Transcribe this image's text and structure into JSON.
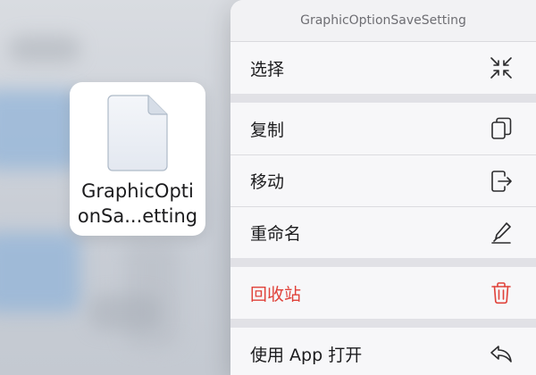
{
  "file": {
    "name_line1": "GraphicOpti",
    "name_line2": "onSa...etting",
    "icon": "document-icon"
  },
  "menu": {
    "title": "GraphicOptionSaveSetting",
    "groups": [
      [
        {
          "label": "选择",
          "icon": "select-arrows-icon"
        }
      ],
      [
        {
          "label": "复制",
          "icon": "duplicate-icon"
        },
        {
          "label": "移动",
          "icon": "move-icon"
        },
        {
          "label": "重命名",
          "icon": "rename-pen-icon"
        }
      ],
      [
        {
          "label": "回收站",
          "icon": "trash-icon",
          "destructive": true
        }
      ],
      [
        {
          "label": "使用 App 打开",
          "icon": "share-arrow-icon"
        }
      ]
    ]
  },
  "colors": {
    "destructive": "#e0423a",
    "menu_background": "#f7f7f9",
    "separator": "#e1e1e6"
  }
}
